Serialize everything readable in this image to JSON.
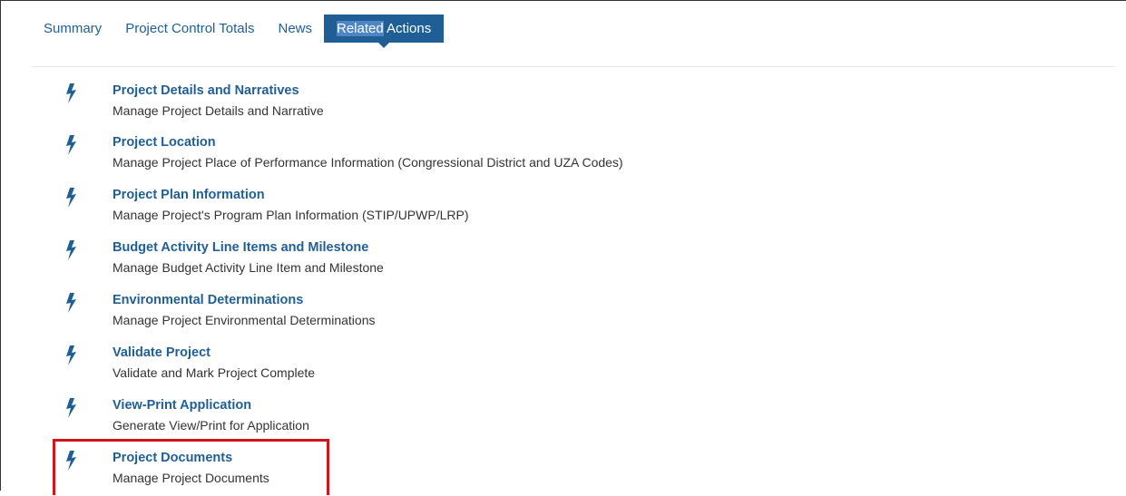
{
  "tabs": [
    {
      "label": "Summary"
    },
    {
      "label": "Project Control Totals"
    },
    {
      "label": "News"
    },
    {
      "label_part1": "Related",
      "label_part2": " Actions"
    }
  ],
  "actions": [
    {
      "title": "Project Details and Narratives",
      "description": "Manage Project Details and Narrative",
      "icon": "bolt-icon"
    },
    {
      "title": "Project Location",
      "description": "Manage Project Place of Performance Information (Congressional District and UZA Codes)",
      "icon": "bolt-icon"
    },
    {
      "title": "Project Plan Information",
      "description": "Manage Project's Program Plan Information (STIP/UPWP/LRP)",
      "icon": "bolt-icon"
    },
    {
      "title": "Budget Activity Line Items and Milestone",
      "description": "Manage Budget Activity Line Item and Milestone",
      "icon": "bolt-icon"
    },
    {
      "title": "Environmental Determinations",
      "description": "Manage Project Environmental Determinations",
      "icon": "bolt-icon"
    },
    {
      "title": "Validate Project",
      "description": "Validate and Mark Project Complete",
      "icon": "bolt-icon"
    },
    {
      "title": "View-Print Application",
      "description": "Generate View/Print for Application",
      "icon": "bolt-icon"
    },
    {
      "title": "Project Documents",
      "description": "Manage Project Documents",
      "icon": "bolt-icon"
    }
  ],
  "colors": {
    "link": "#1f5f95",
    "highlight_border": "#d0161b"
  }
}
